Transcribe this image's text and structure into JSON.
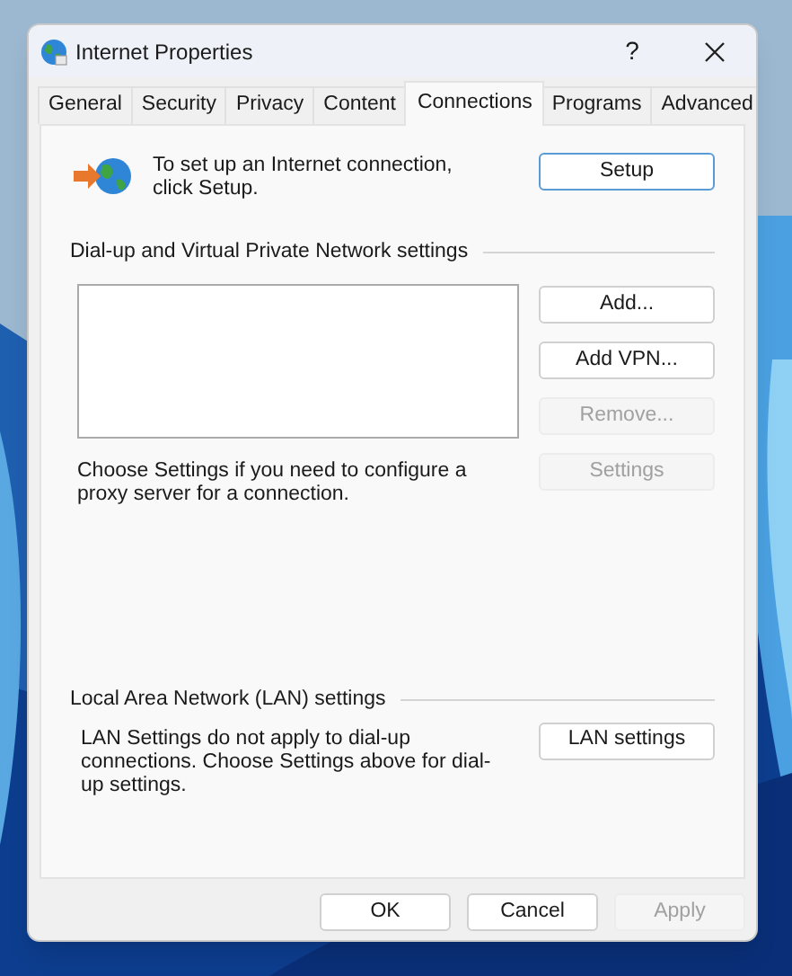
{
  "window": {
    "title": "Internet Properties",
    "help": "?"
  },
  "tabs": [
    {
      "label": "General",
      "selected": false
    },
    {
      "label": "Security",
      "selected": false
    },
    {
      "label": "Privacy",
      "selected": false
    },
    {
      "label": "Content",
      "selected": false
    },
    {
      "label": "Connections",
      "selected": true
    },
    {
      "label": "Programs",
      "selected": false
    },
    {
      "label": "Advanced",
      "selected": false
    }
  ],
  "setup": {
    "text": "To set up an Internet connection, click Setup.",
    "button": "Setup"
  },
  "dialup": {
    "heading": "Dial-up and Virtual Private Network settings",
    "buttons": [
      {
        "label": "Add...",
        "disabled": false
      },
      {
        "label": "Add VPN...",
        "disabled": false
      },
      {
        "label": "Remove...",
        "disabled": true
      }
    ],
    "settings_button": {
      "label": "Settings",
      "disabled": true
    },
    "proxy_text": "Choose Settings if you need to configure a proxy server for a connection."
  },
  "lan": {
    "heading": "Local Area Network (LAN) settings",
    "text": "LAN Settings do not apply to dial-up connections. Choose Settings above for dial-up settings.",
    "button": "LAN settings"
  },
  "footer_buttons": [
    {
      "label": "OK",
      "disabled": false
    },
    {
      "label": "Cancel",
      "disabled": false
    },
    {
      "label": "Apply",
      "disabled": true
    }
  ]
}
